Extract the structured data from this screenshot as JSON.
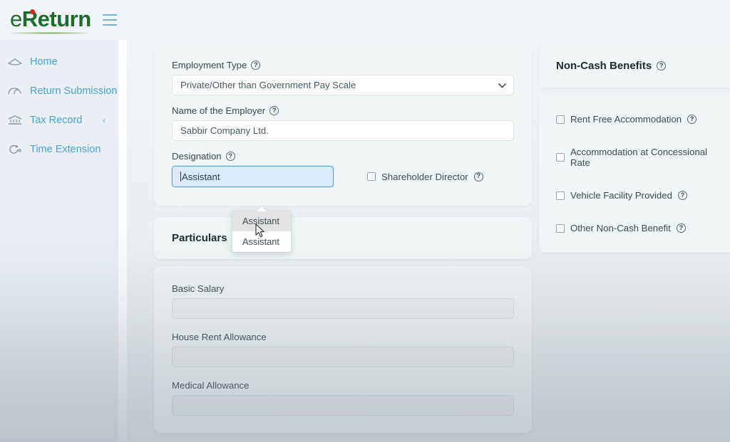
{
  "header": {
    "logo_e": "e",
    "logo_return": "Return",
    "menu_icon": "hamburger-icon"
  },
  "sidebar": {
    "items": [
      {
        "label": "Home",
        "icon": "home-icon",
        "has_chevron": false
      },
      {
        "label": "Return Submission",
        "icon": "return-submission-icon",
        "has_chevron": false
      },
      {
        "label": "Tax Record",
        "icon": "tax-record-icon",
        "has_chevron": true,
        "chevron": "‹"
      },
      {
        "label": "Time Extension",
        "icon": "time-extension-icon",
        "has_chevron": false
      }
    ]
  },
  "main": {
    "employment": {
      "employment_type_label": "Employment Type",
      "employment_type_value": "Private/Other than Government Pay Scale",
      "employer_label": "Name of the Employer",
      "employer_value": "Sabbir Company Ltd.",
      "designation_label": "Designation",
      "designation_value": "Assistant",
      "shareholder_label": "Shareholder Director",
      "shareholder_checked": false
    },
    "designation_dropdown": {
      "options": [
        "Assistant",
        "Assistant"
      ],
      "active_index": 0
    },
    "particulars": {
      "title": "Particulars",
      "fields": [
        {
          "label": "Basic Salary",
          "value": ""
        },
        {
          "label": "House Rent Allowance",
          "value": ""
        },
        {
          "label": "Medical Allowance",
          "value": ""
        }
      ]
    }
  },
  "right_panel": {
    "title": "Non-Cash Benefits",
    "checkboxes": [
      {
        "label": "Rent Free Accommodation",
        "checked": false
      },
      {
        "label": "Accommodation at Concessional Rate",
        "checked": false
      },
      {
        "label": "Vehicle Facility Provided",
        "checked": false
      },
      {
        "label": "Other Non-Cash Benefit",
        "checked": false
      }
    ]
  },
  "icons": {
    "help": "?",
    "chevron_down": "⌄"
  },
  "colors": {
    "brand_green": "#1f6b2a",
    "brand_red": "#e1241b",
    "nav_blue": "#4aa3d4",
    "focus_blue": "#5aa9e6",
    "card_bg": "#f0f7f6"
  }
}
